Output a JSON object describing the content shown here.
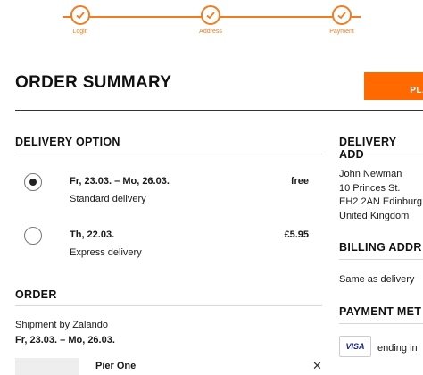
{
  "stepper": {
    "steps": [
      {
        "label": "Login",
        "done": true
      },
      {
        "label": "Address",
        "done": true
      },
      {
        "label": "Payment",
        "done": true
      }
    ],
    "accent_color": "#f47c20"
  },
  "page_title": "ORDER SUMMARY",
  "place_order_label": "PLA",
  "delivery_option": {
    "heading": "DELIVERY OPTION",
    "options": [
      {
        "date": "Fr, 23.03. – Mo, 26.03.",
        "name": "Standard delivery",
        "price": "free",
        "selected": true
      },
      {
        "date": "Th, 22.03.",
        "name": "Express delivery",
        "price": "£5.95",
        "selected": false
      }
    ]
  },
  "order": {
    "heading": "ORDER",
    "shipment_by": "Shipment by Zalando",
    "shipment_dates": "Fr, 23.03. – Mo, 26.03.",
    "item_brand": "Pier One",
    "remove_icon": "close-icon"
  },
  "delivery_address": {
    "heading": "DELIVERY ADD",
    "lines": [
      "John Newman",
      "10 Princes St.",
      "EH2 2AN Edinburg",
      "United Kingdom"
    ]
  },
  "billing_address": {
    "heading": "BILLING ADDR",
    "text": "Same as delivery"
  },
  "payment_method": {
    "heading": "PAYMENT MET",
    "card_brand": "VISA",
    "text": "ending in"
  }
}
